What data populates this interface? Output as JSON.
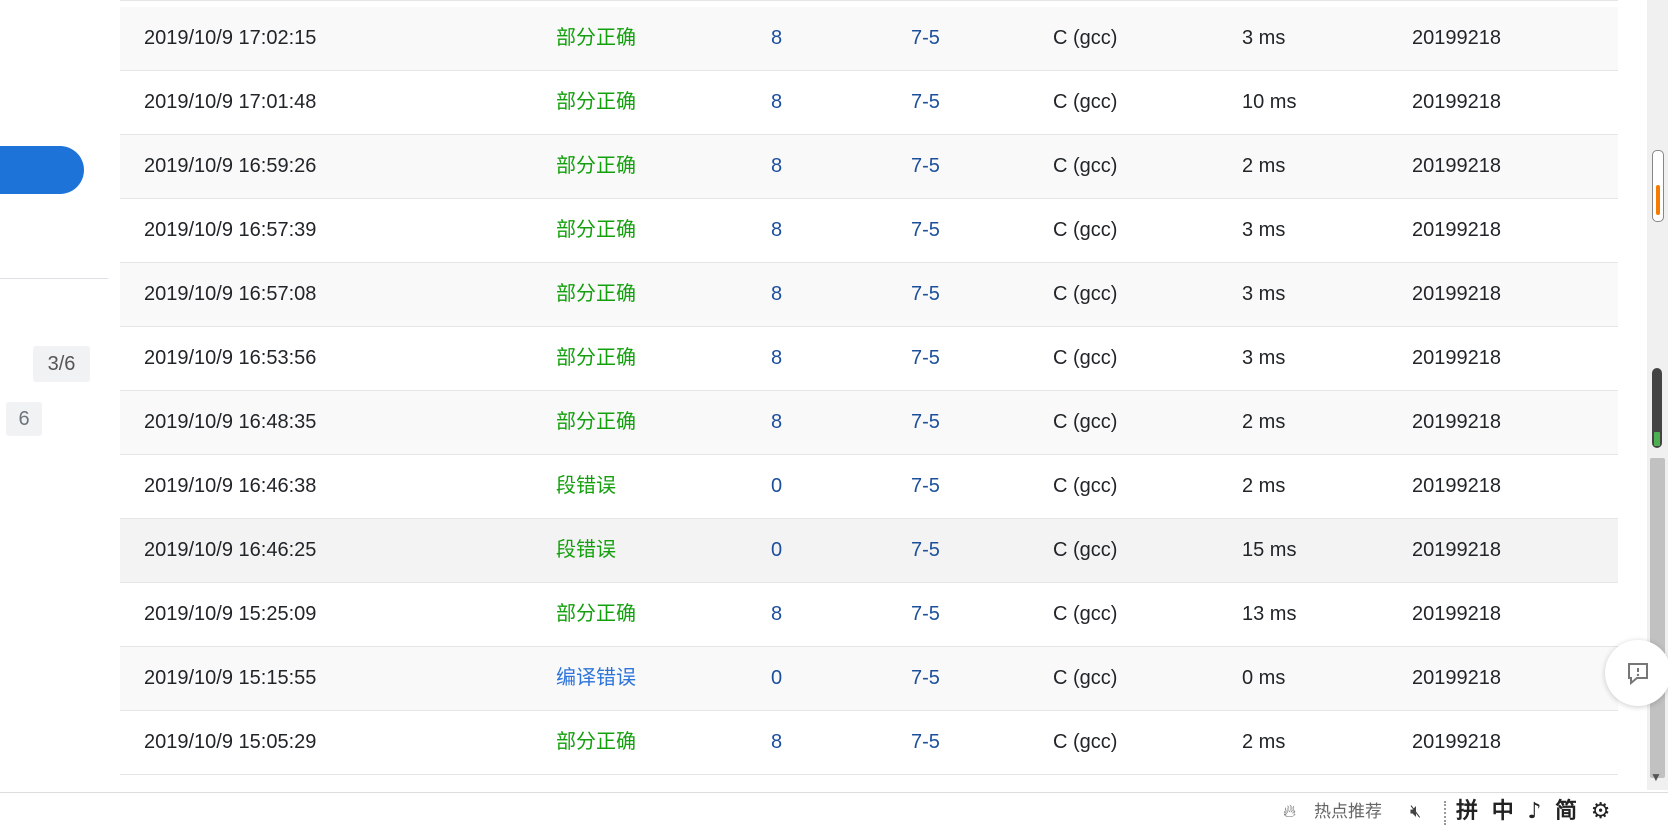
{
  "sidebar": {
    "progress_badge": "3/6",
    "count_badge": "6"
  },
  "submissions": [
    {
      "time": "2019/10/9 17:02:15",
      "status": "部分正确",
      "status_type": "partial",
      "score": "8",
      "problem": "7-5",
      "compiler": "C (gcc)",
      "duration": "3 ms",
      "user": "20199218"
    },
    {
      "time": "2019/10/9 17:01:48",
      "status": "部分正确",
      "status_type": "partial",
      "score": "8",
      "problem": "7-5",
      "compiler": "C (gcc)",
      "duration": "10 ms",
      "user": "20199218"
    },
    {
      "time": "2019/10/9 16:59:26",
      "status": "部分正确",
      "status_type": "partial",
      "score": "8",
      "problem": "7-5",
      "compiler": "C (gcc)",
      "duration": "2 ms",
      "user": "20199218"
    },
    {
      "time": "2019/10/9 16:57:39",
      "status": "部分正确",
      "status_type": "partial",
      "score": "8",
      "problem": "7-5",
      "compiler": "C (gcc)",
      "duration": "3 ms",
      "user": "20199218"
    },
    {
      "time": "2019/10/9 16:57:08",
      "status": "部分正确",
      "status_type": "partial",
      "score": "8",
      "problem": "7-5",
      "compiler": "C (gcc)",
      "duration": "3 ms",
      "user": "20199218"
    },
    {
      "time": "2019/10/9 16:53:56",
      "status": "部分正确",
      "status_type": "partial",
      "score": "8",
      "problem": "7-5",
      "compiler": "C (gcc)",
      "duration": "3 ms",
      "user": "20199218"
    },
    {
      "time": "2019/10/9 16:48:35",
      "status": "部分正确",
      "status_type": "partial",
      "score": "8",
      "problem": "7-5",
      "compiler": "C (gcc)",
      "duration": "2 ms",
      "user": "20199218"
    },
    {
      "time": "2019/10/9 16:46:38",
      "status": "段错误",
      "status_type": "segfault",
      "score": "0",
      "problem": "7-5",
      "compiler": "C (gcc)",
      "duration": "2 ms",
      "user": "20199218"
    },
    {
      "time": "2019/10/9 16:46:25",
      "status": "段错误",
      "status_type": "segfault",
      "score": "0",
      "problem": "7-5",
      "compiler": "C (gcc)",
      "duration": "15 ms",
      "user": "20199218"
    },
    {
      "time": "2019/10/9 15:25:09",
      "status": "部分正确",
      "status_type": "partial",
      "score": "8",
      "problem": "7-5",
      "compiler": "C (gcc)",
      "duration": "13 ms",
      "user": "20199218"
    },
    {
      "time": "2019/10/9 15:15:55",
      "status": "编译错误",
      "status_type": "compile_error",
      "score": "0",
      "problem": "7-5",
      "compiler": "C (gcc)",
      "duration": "0 ms",
      "user": "20199218"
    },
    {
      "time": "2019/10/9 15:05:29",
      "status": "部分正确",
      "status_type": "partial",
      "score": "8",
      "problem": "7-5",
      "compiler": "C (gcc)",
      "duration": "2 ms",
      "user": "20199218"
    }
  ],
  "colors": {
    "partial": "#14a00e",
    "segfault": "#14a00e",
    "compile_error": "#2d74da",
    "link": "#1b4f9c",
    "accent": "#1e73d9"
  },
  "statusbar": {
    "hot_icon": "fire-icon",
    "hot_label": "热点推荐",
    "mute_icon": "speaker-muted-icon",
    "ime_pinyin": "拼",
    "ime_chinese": "中",
    "ime_punct": "♪",
    "ime_simplified": "简"
  }
}
